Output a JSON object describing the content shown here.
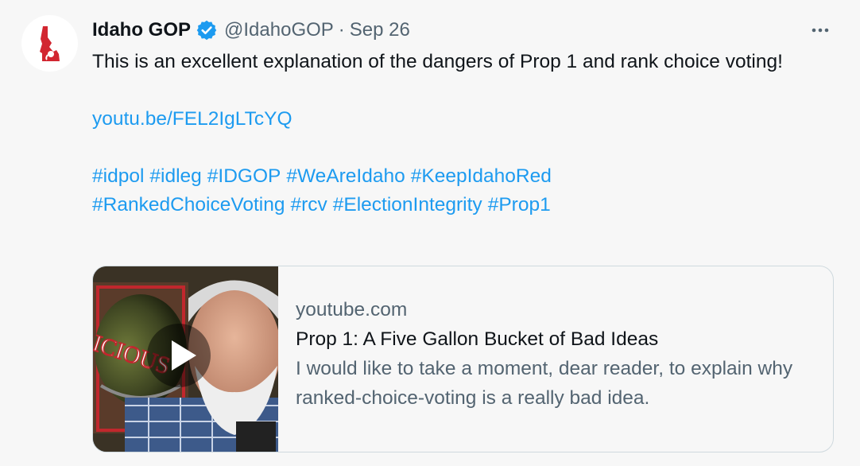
{
  "account": {
    "name": "Idaho GOP",
    "handle": "@IdahoGOP",
    "separator": "·",
    "date": "Sep 26",
    "verified_color": "#1d9bf0",
    "avatar_icon": "idaho-state-elephant-logo",
    "avatar_color": "#d22630"
  },
  "menu": {
    "icon": "more-dots-icon"
  },
  "tweet": {
    "text_line": "This is an excellent explanation of the dangers of Prop 1 and rank choice voting!",
    "link": "youtu.be/FEL2IgLTcYQ",
    "hashtags": [
      "#idpol",
      "#idleg",
      "#IDGOP",
      "#WeAreIdaho",
      "#KeepIdahoRed",
      "#RankedChoiceVoting",
      "#rcv",
      "#ElectionIntegrity",
      "#Prop1"
    ],
    "link_color": "#1d9bf0"
  },
  "card": {
    "domain": "youtube.com",
    "title": "Prop 1: A Five Gallon Bucket of Bad Ideas",
    "description": "I would like to take a moment, dear reader, to explain why ranked-choice-voting is a really bad idea.",
    "thumbnail_text": "ICIOUS",
    "play_icon": "play-icon"
  }
}
